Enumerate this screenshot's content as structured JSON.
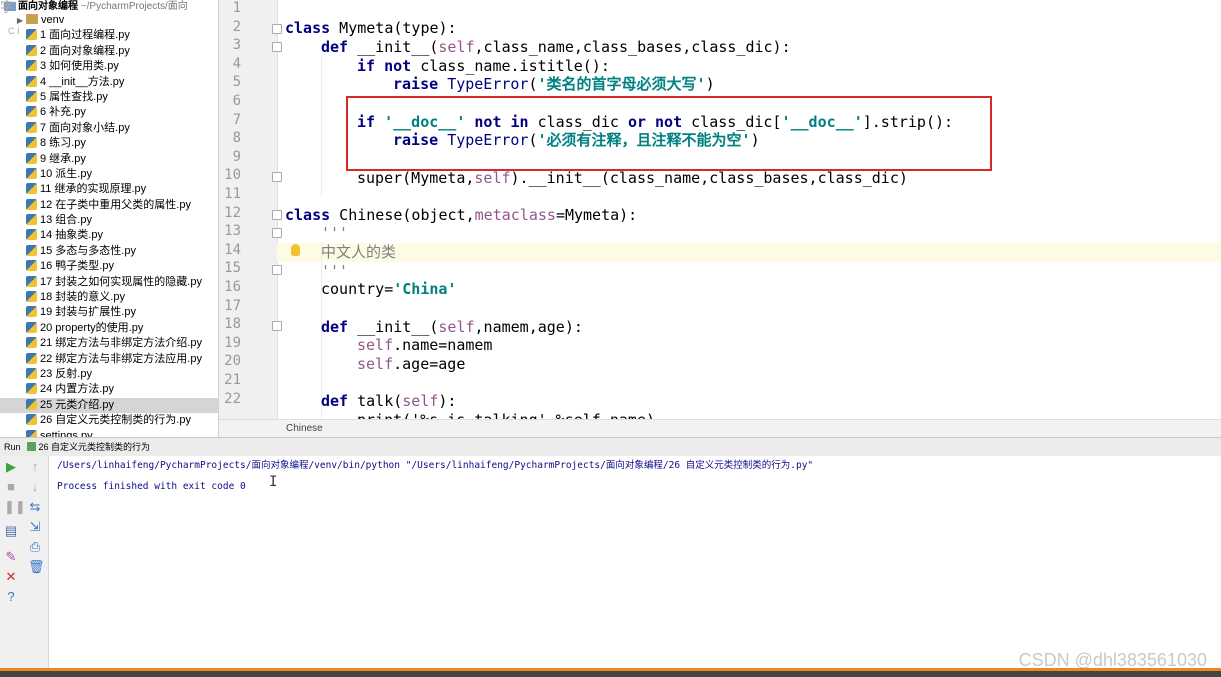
{
  "project": {
    "name": "面向对象编程",
    "path": "~/PycharmProjects/面向",
    "overlay_char": "字",
    "overlay_sub": "C I"
  },
  "tree": {
    "folder": "venv",
    "files": [
      "1 面向过程编程.py",
      "2 面向对象编程.py",
      "3 如何使用类.py",
      "4 __init__方法.py",
      "5 属性查找.py",
      "6 补充.py",
      "7 面向对象小结.py",
      "8 练习.py",
      "9 继承.py",
      "10 派生.py",
      "11 继承的实现原理.py",
      "12 在子类中重用父类的属性.py",
      "13 组合.py",
      "14 抽象类.py",
      "15 多态与多态性.py",
      "16 鸭子类型.py",
      "17 封装之如何实现属性的隐藏.py",
      "18 封装的意义.py",
      "19 封装与扩展性.py",
      "20 property的使用.py",
      "21 绑定方法与非绑定方法介绍.py",
      "22 绑定方法与非绑定方法应用.py",
      "23 反射.py",
      "24 内置方法.py",
      "25 元类介绍.py",
      "26 自定义元类控制类的行为.py",
      "settings.py"
    ],
    "selected_index": 24
  },
  "editor": {
    "line_numbers": [
      "1",
      "2",
      "3",
      "4",
      "5",
      "6",
      "7",
      "8",
      "9",
      "10",
      "11",
      "12",
      "13",
      "14",
      "15",
      "16",
      "17",
      "18",
      "19",
      "20",
      "21",
      "22"
    ],
    "breadcrumb": "Chinese",
    "lines": {
      "l2": {
        "kw1": "class",
        "t1": " Mymeta(type):"
      },
      "l3": {
        "kw1": "def",
        "t1": " __init__(",
        "self1": "self",
        "t2": ",class_name,class_bases,class_dic):"
      },
      "l4": {
        "kw1": "if",
        "sp": " ",
        "kw2": "not",
        "t1": " class_name.istitle():"
      },
      "l5": {
        "kw1": "raise",
        "t1": " ",
        "b1": "TypeError",
        "t2": "(",
        "s1": "'类名的首字母必须大写'",
        "t3": ")"
      },
      "l7": {
        "kw1": "if",
        "sp": " ",
        "s1": "'__doc__'",
        "sp2": " ",
        "kw2": "not in",
        "t1": " class_dic ",
        "kw3": "or not",
        "t2": " class_dic[",
        "s2": "'__doc__'",
        "t3": "].strip():"
      },
      "l8": {
        "kw1": "raise",
        "t1": " ",
        "b1": "TypeError",
        "t2": "(",
        "s1": "'必须有注释，且注释不能为空'",
        "t3": ")"
      },
      "l10": {
        "t1": "super(Mymeta,",
        "self1": "self",
        "t2": ").__init__(class_name,class_bases,class_dic)"
      },
      "l12": {
        "kw1": "class",
        "t1": " Chinese(object,",
        "self1": "metaclass",
        "t2": "=Mymeta):"
      },
      "l13": {
        "d1": "'''"
      },
      "l14": {
        "d1": "中文人的类"
      },
      "l15": {
        "d1": "'''"
      },
      "l16": {
        "t1": "country=",
        "s1": "'China'"
      },
      "l18": {
        "kw1": "def",
        "t1": " __init__(",
        "self1": "self",
        "t2": ",namem,age):"
      },
      "l19": {
        "self1": "self",
        "t1": ".name=namem"
      },
      "l20": {
        "self1": "self",
        "t1": ".age=age"
      },
      "l22": {
        "kw1": "def",
        "t1": " talk(",
        "self1": "self",
        "t2": "):"
      },
      "l23": {
        "t1": "print('%s is talking' %self.name)"
      }
    }
  },
  "run": {
    "label": "Run",
    "tab": "26 自定义元类控制类的行为",
    "cmd": "/Users/linhaifeng/PycharmProjects/面向对象编程/venv/bin/python \"/Users/linhaifeng/PycharmProjects/面向对象编程/26 自定义元类控制类的行为.py\"",
    "exit": "Process finished with exit code 0",
    "cursor": "I"
  },
  "watermark": "CSDN @dhl383561030",
  "colors": {
    "keyword": "#000080",
    "string": "#008080",
    "self": "#94558d",
    "docstring": "#808080",
    "highlight_box": "#d62a2a"
  }
}
